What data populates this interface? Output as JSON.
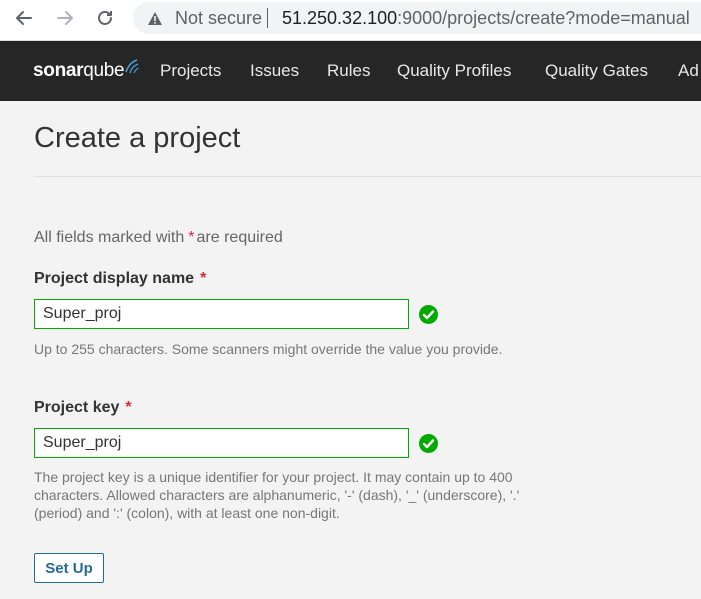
{
  "browser": {
    "security_label": "Not secure",
    "url_host": "51.250.32.100",
    "url_path": ":9000/projects/create?mode=manual"
  },
  "nav": {
    "logo_sonar": "sonar",
    "logo_qube": "qube",
    "items": [
      {
        "label": "Projects"
      },
      {
        "label": "Issues"
      },
      {
        "label": "Rules"
      },
      {
        "label": "Quality Profiles"
      },
      {
        "label": "Quality Gates"
      },
      {
        "label": "Ad"
      }
    ]
  },
  "page": {
    "title": "Create a project",
    "required_prefix": "All fields marked with",
    "required_star": "*",
    "required_suffix": "are required"
  },
  "form": {
    "display_name": {
      "label": "Project display name",
      "star": "*",
      "value": "Super_proj",
      "help": "Up to 255 characters. Some scanners might override the value you provide."
    },
    "project_key": {
      "label": "Project key",
      "star": "*",
      "value": "Super_proj",
      "help": "The project key is a unique identifier for your project. It may contain up to 400 characters. Allowed characters are alphanumeric, '-' (dash), '_' (underscore), '.' (period) and ':' (colon), with at least one non-digit."
    },
    "submit_label": "Set Up"
  },
  "colors": {
    "nav_bg": "#262626",
    "valid_green": "#00aa00",
    "required_red": "#d02f3a",
    "button_blue": "#236a97"
  }
}
